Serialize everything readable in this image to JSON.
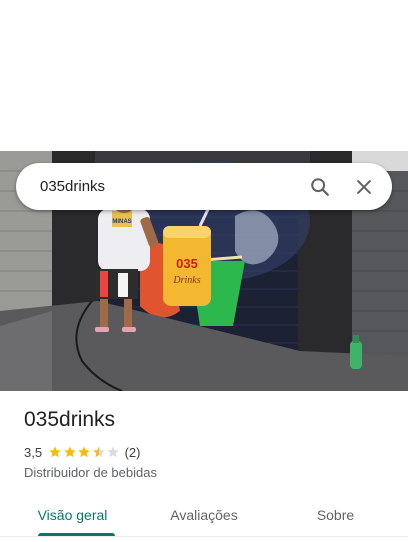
{
  "search": {
    "value": "035drinks",
    "placeholder": ""
  },
  "place": {
    "name": "035drinks",
    "rating": "3,5",
    "rating_value": 3.5,
    "review_count": "(2)",
    "category": "Distribuidor de bebidas"
  },
  "photo_text": {
    "shirt": "MINAS",
    "can_top": "035",
    "can_bottom": "Drinks"
  },
  "tabs": [
    {
      "label": "Visão geral",
      "active": true
    },
    {
      "label": "Avaliações",
      "active": false
    },
    {
      "label": "Sobre",
      "active": false
    }
  ],
  "colors": {
    "accent": "#00796b",
    "star": "#fbbc04",
    "star_empty": "#dadce0"
  },
  "icons": {
    "search": "search-icon",
    "close": "close-icon"
  }
}
